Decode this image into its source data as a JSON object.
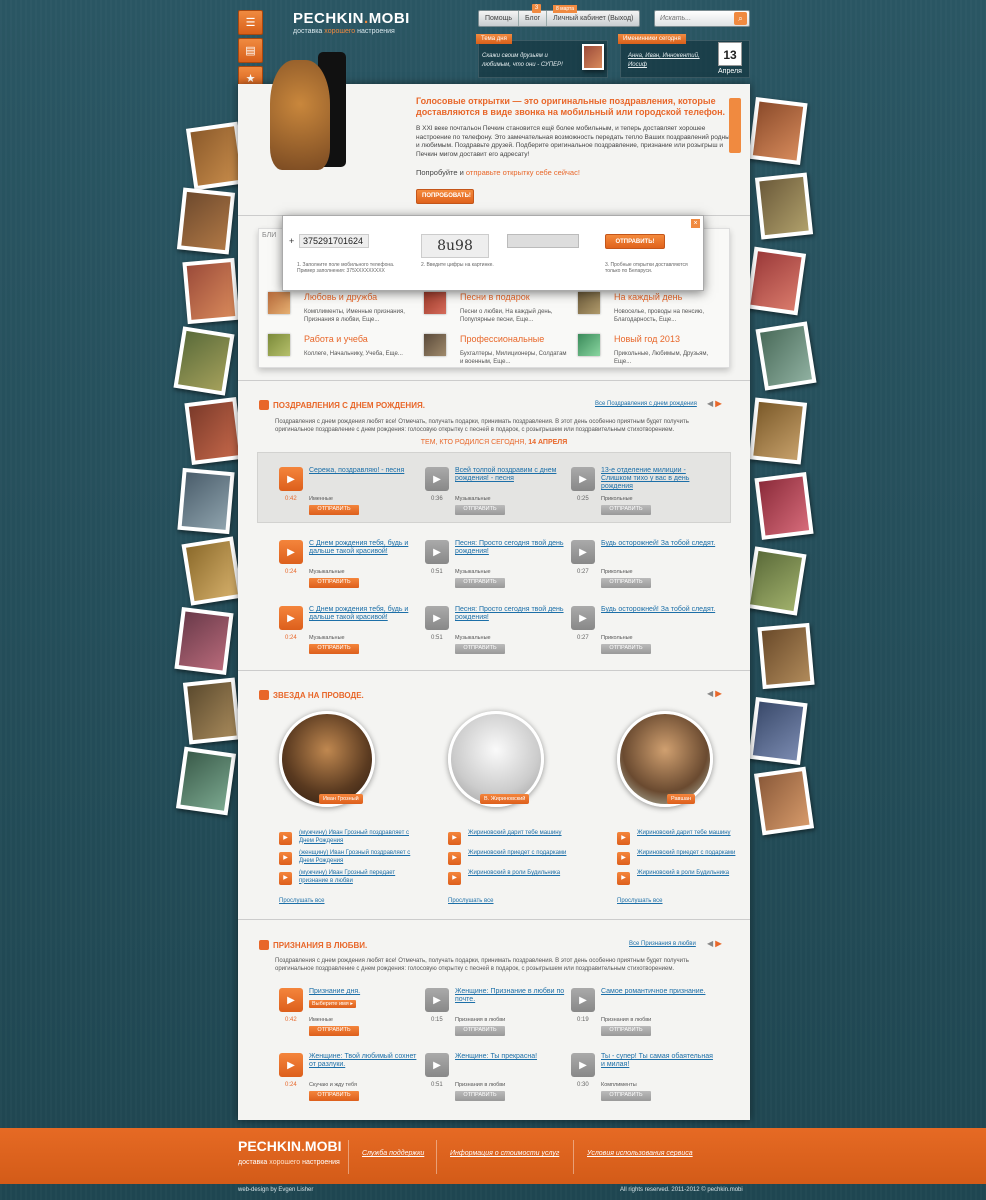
{
  "header": {
    "logo_main": "PECHKIN",
    "logo_dot": ".",
    "logo_end": "MOBI",
    "tagline_pre": "доставка ",
    "tagline_accent": "хорошего",
    "tagline_post": " настроения",
    "nav": [
      "Помощь",
      "Блог",
      "Личный кабинет (Выход)"
    ],
    "nav_badge": "3",
    "nav_badge2": "8 марта",
    "search_placeholder": "Искать...",
    "theme_title": "Тема дня",
    "theme_text": "Скажи своим друзьям и любимым, что они - СУПЕР!",
    "names_title": "Именинники сегодня",
    "names_text": "Анна, Иван, Иннокентий, Иосиф",
    "cal_day": "13",
    "cal_month": "Апреля"
  },
  "hero": {
    "title": "Голосовые открытки — это оригинальные поздравления, которые доставляются в виде звонка на мобильный или городской телефон.",
    "text": "В XXI веке почтальон Печкин становится ещё более мобильным, и теперь доставляет хорошее настроение по телефону. Это замечательная возможность передать тепло Ваших поздравлений родным и любимым. Поздравьте друзей. Подберите оригинальное поздравление, признание или розыгрыш и Печкин мигом доставит его адресату!",
    "try_pre": "Попробуйте и ",
    "try_link": "отправьте открытку себе сейчас!",
    "button": "ПОПРОБОВАТЬ!"
  },
  "popup": {
    "phone_prefix": "+",
    "phone_value": "375291701624",
    "captcha": "8u98",
    "send": "ОТПРАВИТЬ!",
    "note1": "1. Заполните поле мобильного телефона. Пример заполнения: 375XXXXXXXXX",
    "note2": "2. Введите цифры на картинке.",
    "note3": "3. Пробные открытки доставляются только по Беларуси.",
    "behind_tab": "БЛИ"
  },
  "categories": [
    {
      "title": "Любовь и дружба",
      "desc": "Комплименты, Именные признания, Признания в любви, Еще..."
    },
    {
      "title": "Песни в подарок",
      "desc": "Песни о любви, На каждый день, Популярные песни, Еще..."
    },
    {
      "title": "На каждый день",
      "desc": "Новоселье, проводы на пенсию, Благодарность, Еще..."
    },
    {
      "title": "Работа и учеба",
      "desc": "Коллеге, Начальнику, Учеба, Еще..."
    },
    {
      "title": "Профессиональные",
      "desc": "Бухгалтеры, Милиционеры, Солдатам и военным, Еще..."
    },
    {
      "title": "Новый год 2013",
      "desc": "Прикольные, Любимым, Друзьям, Еще..."
    }
  ],
  "birthday": {
    "heading": "ПОЗДРАВЛЕНИЯ С ДНЕМ РОЖДЕНИЯ.",
    "all_link": "Все Поздравления с днем рождения",
    "desc": "Поздравления с днем рождения любят все! Отмечать, получать подарки, принимать поздравления. В этот день особенно приятным будет получить оригинальное поздравление с днем рождения: голосовую открытку с песней в подарок, с розыгрышем или поздравительным стихотворением.",
    "sub_pre": "ТЕМ, КТО РОДИЛСЯ СЕГОДНЯ, ",
    "sub_date": "14 АПРЕЛЯ",
    "tracks": [
      {
        "title": "Сережа, поздравляю! - песня",
        "dur": "0:42",
        "cat": "Именные",
        "send": "ОТПРАВИТЬ"
      },
      {
        "title": "Всей толпой поздравим с днем рождения! - песня",
        "dur": "0:36",
        "cat": "Музыкальные",
        "send": "ОТПРАВИТЬ"
      },
      {
        "title": "13-е отделение милиции - Слишком тихо у вас в день рождения",
        "dur": "0:25",
        "cat": "Прикольные",
        "send": "ОТПРАВИТЬ"
      },
      {
        "title": "С Днем рождения тебя, будь и дальше такой красивой!",
        "dur": "0:24",
        "cat": "Музыкальные",
        "send": "ОТПРАВИТЬ"
      },
      {
        "title": "Песня: Просто сегодня твой день рождения!",
        "dur": "0:51",
        "cat": "Музыкальные",
        "send": "ОТПРАВИТЬ"
      },
      {
        "title": "Будь осторожней! За тобой следят.",
        "dur": "0:27",
        "cat": "Прикольные",
        "send": "ОТПРАВИТЬ"
      },
      {
        "title": "С Днем рождения тебя, будь и дальше такой красивой!",
        "dur": "0:24",
        "cat": "Музыкальные",
        "send": "ОТПРАВИТЬ"
      },
      {
        "title": "Песня: Просто сегодня твой день рождения!",
        "dur": "0:51",
        "cat": "Музыкальные",
        "send": "ОТПРАВИТЬ"
      },
      {
        "title": "Будь осторожней! За тобой следят.",
        "dur": "0:27",
        "cat": "Прикольные",
        "send": "ОТПРАВИТЬ"
      }
    ]
  },
  "stars": {
    "heading": "ЗВЕЗДА НА ПРОВОДЕ.",
    "listen_all": "Прослушать все",
    "people": [
      {
        "name": "Иван Грозный",
        "items": [
          "(мужчину) Иван Грозный поздравляет с Днем Рождения",
          "(женщину) Иван Грозный поздравляет с Днем Рождения",
          "(мужчину) Иван Грозный передает признание в любви"
        ]
      },
      {
        "name": "В. Жириновский",
        "items": [
          "Жириновский дарит тебе машину",
          "Жириновский приедет с подарками",
          "Жириновский в роли Будильника"
        ]
      },
      {
        "name": "Равшан",
        "items": [
          "Жириновский дарит тебе машину",
          "Жириновский приедет с подарками",
          "Жириновский в роли Будильника"
        ]
      }
    ]
  },
  "love": {
    "heading": "ПРИЗНАНИЯ В ЛЮБВИ.",
    "all_link": "Все Признания в любви",
    "desc": "Поздравления с днем рождения любят все! Отмечать, получать подарки, принимать поздравления. В этот день особенно приятным будет получить оригинальное поздравление с днем рождения: голосовую открытку с песней в подарок, с розыгрышем или поздравительным стихотворением.",
    "select_name": "Выберите имя",
    "tracks": [
      {
        "title": "Признание дня.",
        "dur": "0:42",
        "cat": "Именные",
        "send": "ОТПРАВИТЬ"
      },
      {
        "title": "Женщине: Признание в любви по почте.",
        "dur": "0:15",
        "cat": "Признания в любви",
        "send": "ОТПРАВИТЬ"
      },
      {
        "title": "Самое романтичное признание.",
        "dur": "0:19",
        "cat": "Признания в любви",
        "send": "ОТПРАВИТЬ"
      },
      {
        "title": "Женщине: Твой любимый сохнет от разлуки.",
        "dur": "0:24",
        "cat": "Скучаю и жду тебя",
        "send": "ОТПРАВИТЬ"
      },
      {
        "title": "Женщине: Ты прекрасна!",
        "dur": "0:51",
        "cat": "Признания в любви",
        "send": "ОТПРАВИТЬ"
      },
      {
        "title": "Ты - супер! Ты самая обаятельная и милая!",
        "dur": "0:30",
        "cat": "Комплименты",
        "send": "ОТПРАВИТЬ"
      }
    ]
  },
  "footer": {
    "logo_main": "PECHKIN",
    "logo_dot": ".",
    "logo_end": "MOBI",
    "tag_pre": "доставка ",
    "tag_accent": "хорошего",
    "tag_post": " настроения",
    "links": [
      "Служба поддержки",
      "Информация о стоимости услуг",
      "Условия использования сервиса"
    ],
    "credit_left": "web-design by Evgen Lisher",
    "credit_right": "All rights reserved. 2011-2012 © pechkin.mobi"
  },
  "colors": {
    "accent": "#e8672a",
    "bg": "#24505c",
    "link": "#1c6fa8"
  }
}
